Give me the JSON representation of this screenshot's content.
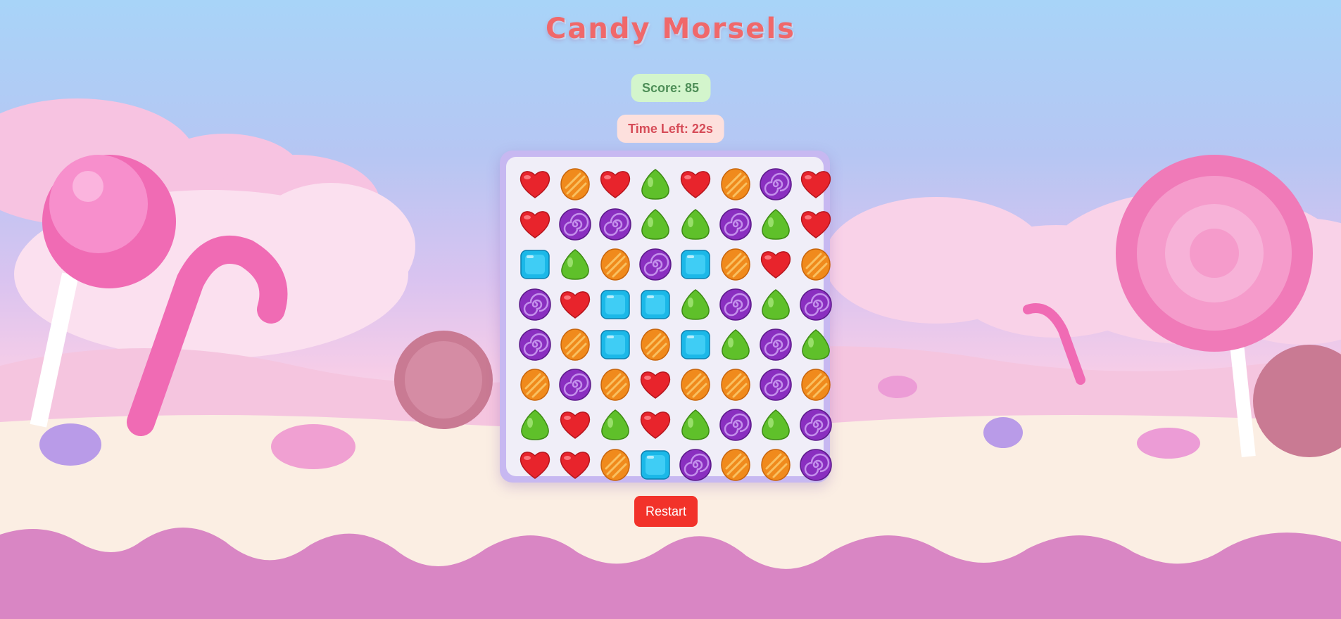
{
  "game": {
    "title": "Candy Morsels",
    "score_text": "Score: 85",
    "score": 85,
    "time_text": "Time Left: 22s",
    "time_left_seconds": 22,
    "restart_label": "Restart"
  },
  "board": {
    "rows": 8,
    "cols": 8,
    "cells": [
      [
        "heart",
        "orange",
        "heart",
        "green",
        "heart",
        "orange",
        "purple",
        "heart"
      ],
      [
        "heart",
        "purple",
        "purple",
        "green",
        "green",
        "purple",
        "green",
        "heart"
      ],
      [
        "blue",
        "green",
        "orange",
        "purple",
        "blue",
        "orange",
        "heart",
        "orange"
      ],
      [
        "purple",
        "heart",
        "blue",
        "blue",
        "green",
        "purple",
        "green",
        "purple"
      ],
      [
        "purple",
        "orange",
        "blue",
        "orange",
        "blue",
        "green",
        "purple",
        "green"
      ],
      [
        "orange",
        "purple",
        "orange",
        "heart",
        "orange",
        "orange",
        "purple",
        "orange"
      ],
      [
        "green",
        "heart",
        "green",
        "heart",
        "green",
        "purple",
        "green",
        "purple"
      ],
      [
        "heart",
        "heart",
        "orange",
        "blue",
        "purple",
        "orange",
        "orange",
        "purple"
      ]
    ]
  },
  "candy_icons": {
    "heart": "red-heart-candy-icon",
    "orange": "orange-striped-candy-icon",
    "green": "green-gumdrop-candy-icon",
    "purple": "purple-swirl-candy-icon",
    "blue": "blue-square-candy-icon"
  },
  "colors": {
    "heart": "#e8242c",
    "orange": "#f08a1c",
    "green": "#5fc02a",
    "purple": "#8a2fc0",
    "blue": "#1bb8e8",
    "restart": "#f2322a"
  }
}
